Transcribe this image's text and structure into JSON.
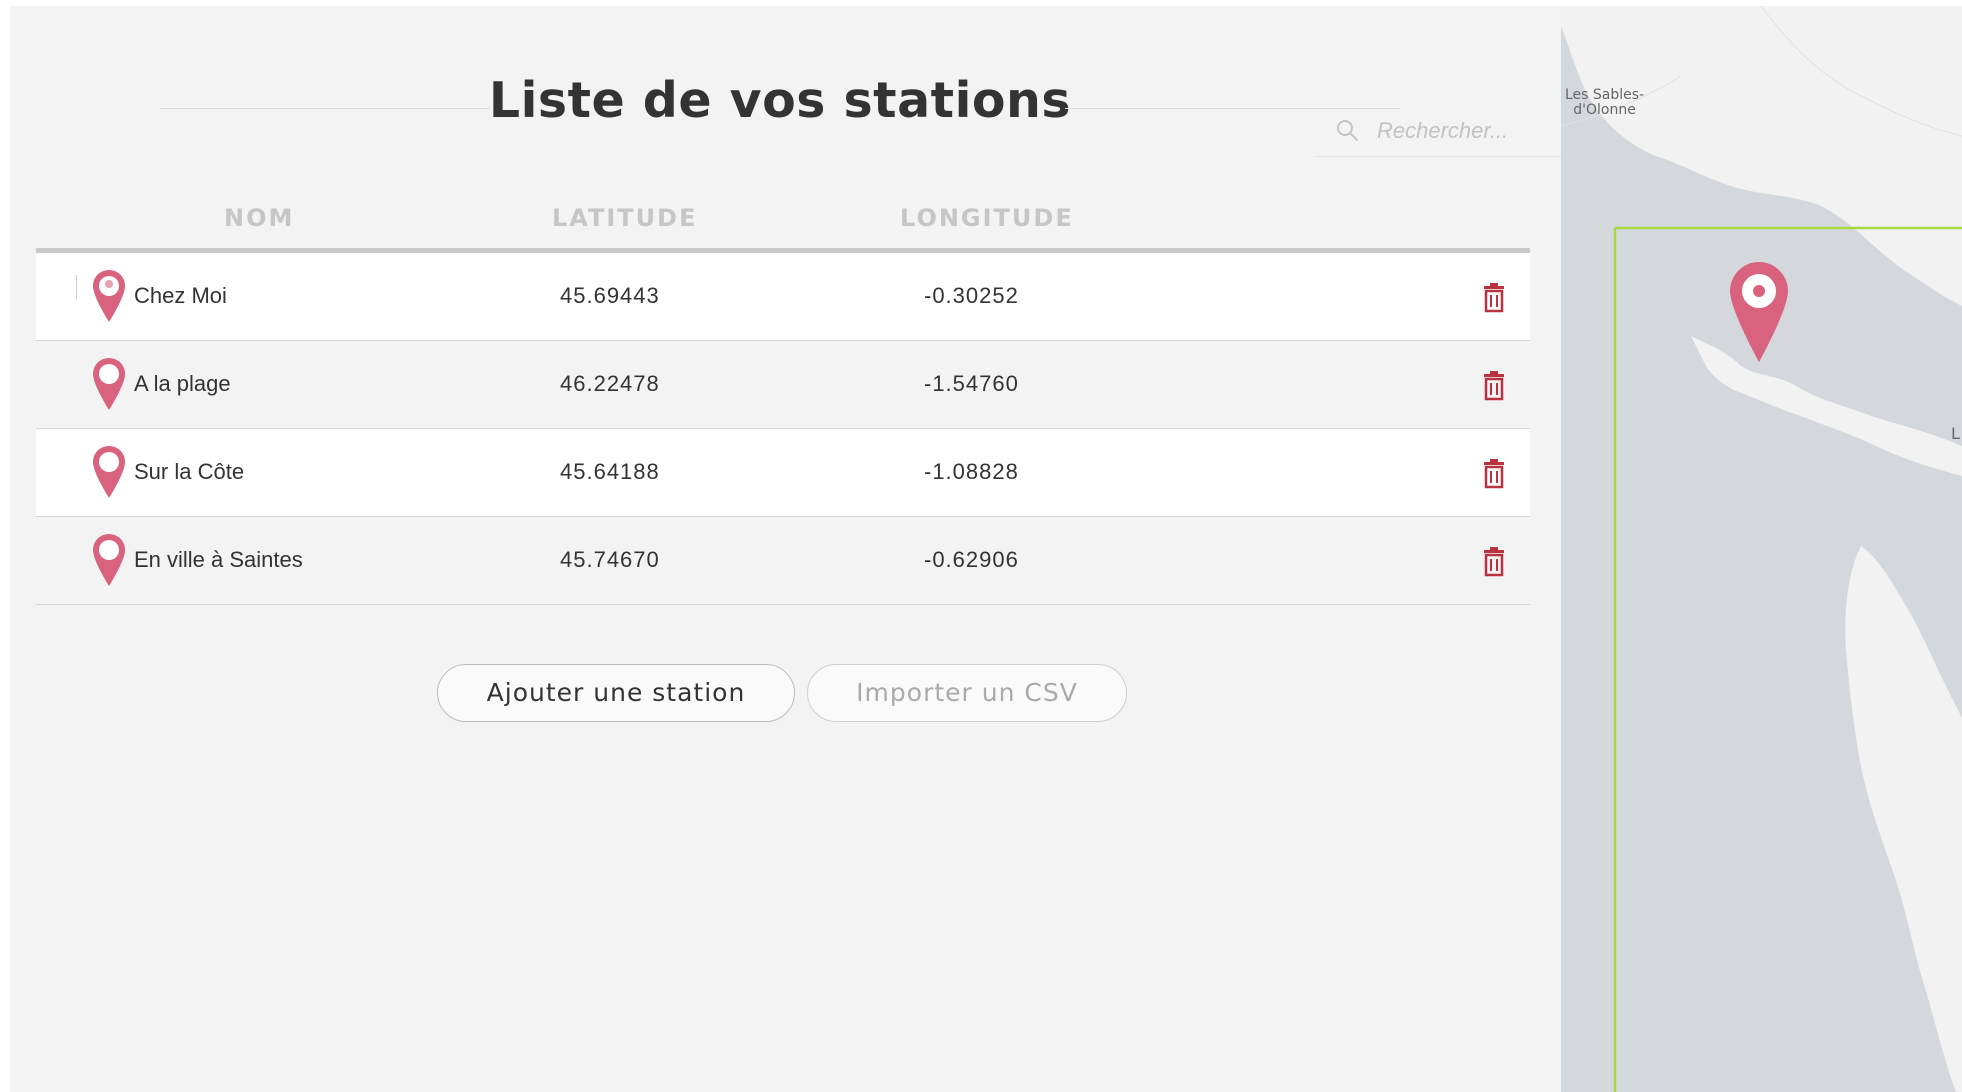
{
  "page": {
    "title": "Liste de vos stations"
  },
  "search": {
    "placeholder": "Rechercher..."
  },
  "table": {
    "headers": {
      "name": "NOM",
      "latitude": "LATITUDE",
      "longitude": "LONGITUDE"
    },
    "rows": [
      {
        "name": "Chez Moi",
        "latitude": "45.69443",
        "longitude": "-0.30252"
      },
      {
        "name": "A la plage",
        "latitude": "46.22478",
        "longitude": "-1.54760"
      },
      {
        "name": "Sur la Côte",
        "latitude": "45.64188",
        "longitude": "-1.08828"
      },
      {
        "name": "En ville à Saintes",
        "latitude": "45.74670",
        "longitude": "-0.62906"
      }
    ]
  },
  "actions": {
    "add_label": "Ajouter une station",
    "import_label": "Importer un CSV"
  },
  "map": {
    "place_label_line1": "Les Sables-",
    "place_label_line2": "d'Olonne",
    "edge_label": "L"
  },
  "colors": {
    "accent": "#d9627f",
    "trash": "#b8323f",
    "selection": "#a7d940",
    "panel": "#f3f3f3"
  },
  "icons": {
    "pin": "map-pin-icon",
    "trash": "trash-icon",
    "search": "search-icon"
  }
}
